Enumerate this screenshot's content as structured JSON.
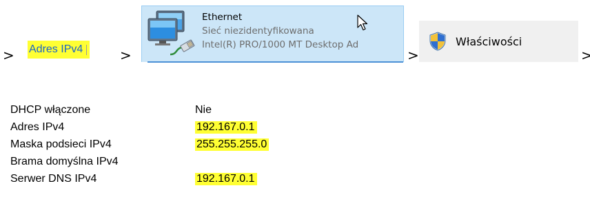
{
  "breadcrumb": {
    "step1_label": "Adres IPv4",
    "step2": {
      "name": "Ethernet",
      "status": "Sieć niezidentyfikowana",
      "adapter": "Intel(R) PRO/1000 MT Desktop Ad"
    },
    "step3_label": "Właściwości",
    "separator": ">"
  },
  "details": {
    "rows": [
      {
        "label": "DHCP włączone",
        "value": ""
      },
      {
        "label": "Adres IPv4",
        "value": "192.167.0.1"
      },
      {
        "label": "Maska podsieci IPv4",
        "value": "255.255.255.0"
      },
      {
        "label": "Brama domyślna IPv4",
        "value": ""
      },
      {
        "label": "Serwer DNS IPv4",
        "value": "192.167.0.1"
      }
    ],
    "dhcp_value": "Nie"
  },
  "icons": {
    "network": "network-computers-icon",
    "cursor": "mouse-pointer-icon",
    "shield": "uac-shield-icon"
  },
  "colors": {
    "highlight": "#ffff33",
    "link_blue": "#1a63c8",
    "tile_bg": "#cce6f8",
    "tile_border": "#99cdf3",
    "button_bg": "#f0f0f0"
  }
}
